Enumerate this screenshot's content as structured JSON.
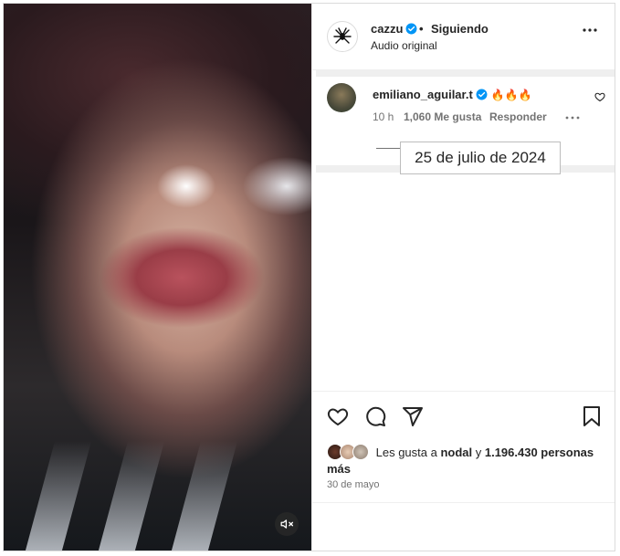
{
  "post": {
    "author": "cazzu",
    "dot": "•",
    "follow_label": "Siguiendo",
    "audio_label": "Audio original"
  },
  "comment": {
    "username": "emiliano_aguilar.t",
    "text": "🔥🔥🔥",
    "time": "10 h",
    "likes": "1,060 Me gusta",
    "reply_label": "Responder"
  },
  "annotation": {
    "date": "25 de julio de 2024"
  },
  "likes": {
    "prefix": "Les gusta a ",
    "user": "nodal",
    "middle": " y ",
    "count": "1.196.430 personas más"
  },
  "post_date": "30 de mayo",
  "icons": {
    "verified": "verified-badge-icon",
    "more": "more-options-icon",
    "heart": "heart-icon",
    "comment": "comment-icon",
    "share": "share-icon",
    "save": "bookmark-icon",
    "mute": "muted-speaker-icon"
  },
  "colors": {
    "verified": "#0095f6",
    "border": "#dbdbdb",
    "muted_text": "#737373"
  }
}
